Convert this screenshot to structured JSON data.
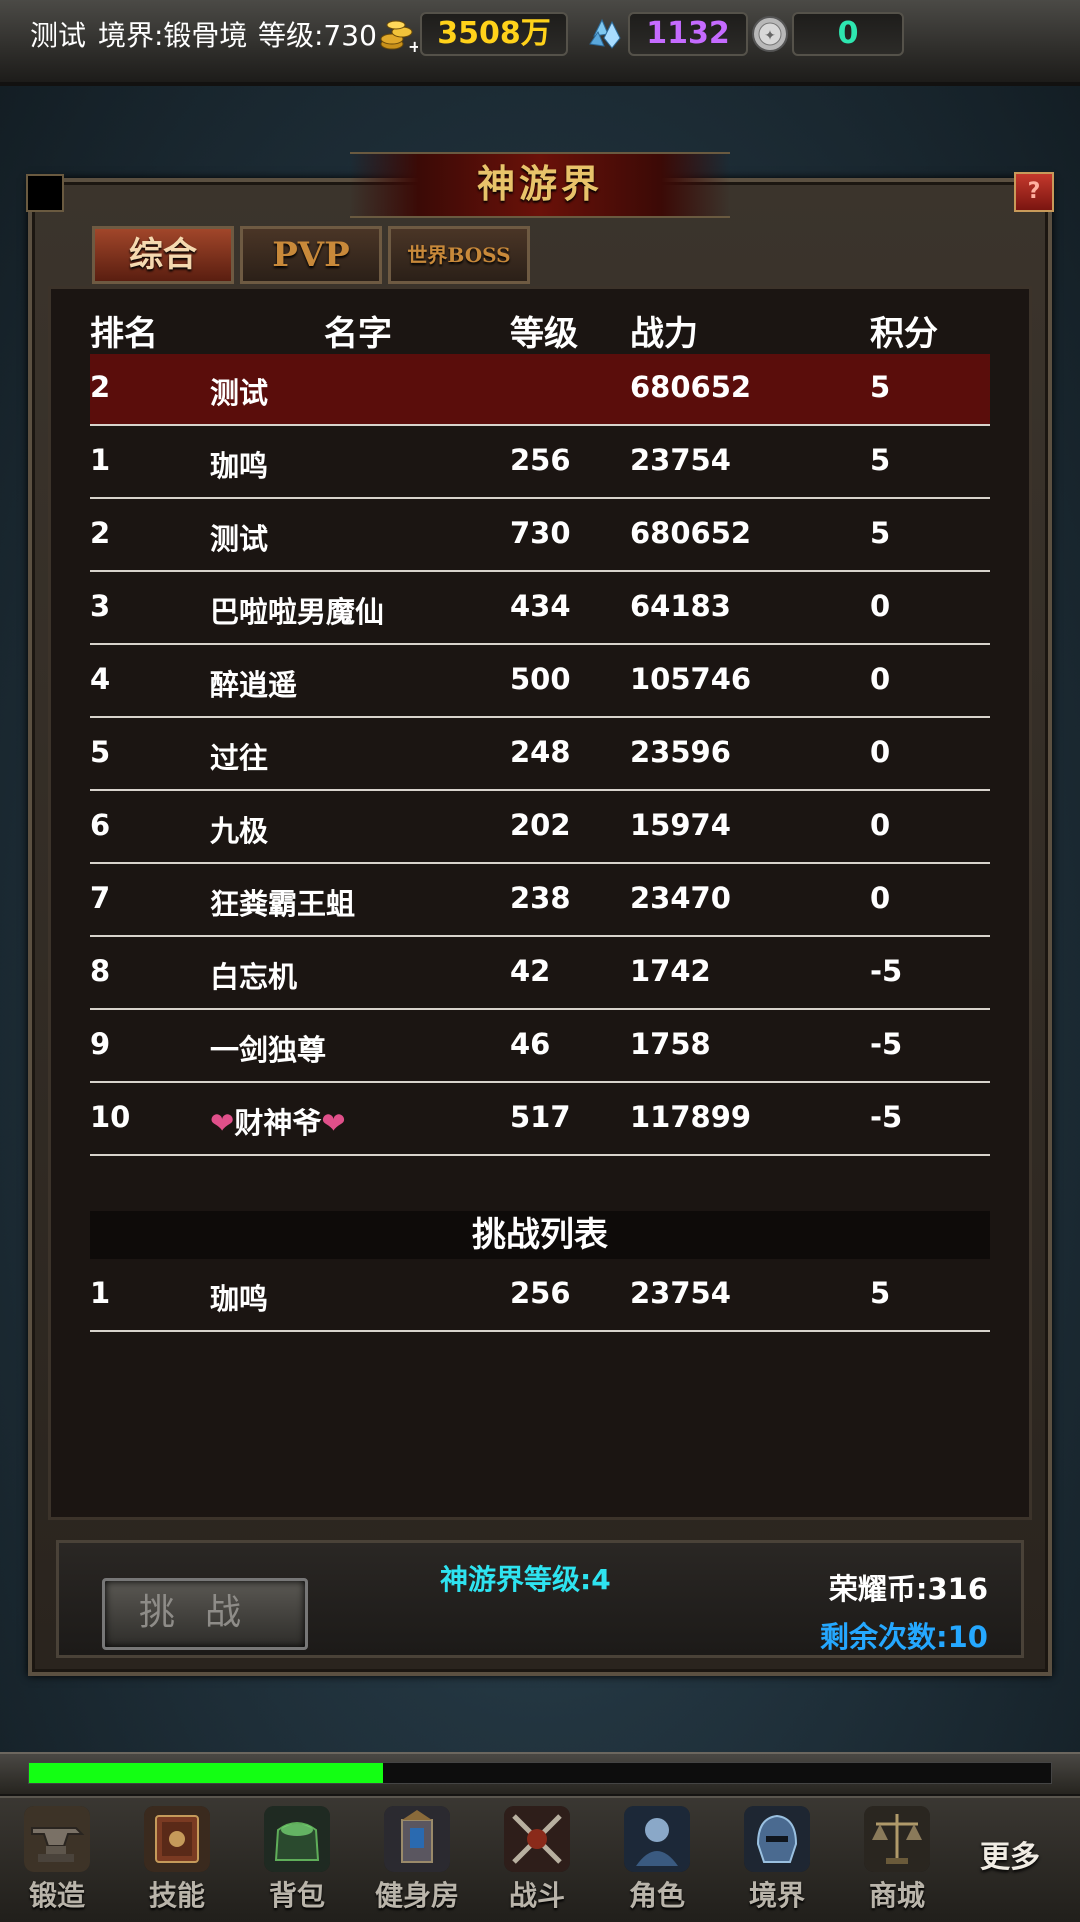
{
  "top_bar": {
    "player_name": "测试",
    "realm": "境界:锻骨境",
    "level": "等级:730",
    "gold": "3508万",
    "crystal": "1132",
    "coin": "0",
    "colors": {
      "gold": "#ffd21a",
      "crystal": "#c56bff",
      "coin": "#2ee6b0"
    }
  },
  "panel": {
    "title": "神游界",
    "help_label": "?",
    "tabs": [
      {
        "label": "综合",
        "active": true
      },
      {
        "label": "PVP",
        "active": false
      },
      {
        "label": "世界BOSS",
        "active": false
      }
    ]
  },
  "ranking": {
    "headers": [
      "排名",
      "名字",
      "等级",
      "战力",
      "积分"
    ],
    "self_row": {
      "rank": "2",
      "name": "测试",
      "level": "",
      "power": "680652",
      "score": "5"
    },
    "rows": [
      {
        "rank": "1",
        "name": "珈鸣",
        "level": "256",
        "power": "23754",
        "score": "5"
      },
      {
        "rank": "2",
        "name": "测试",
        "level": "730",
        "power": "680652",
        "score": "5"
      },
      {
        "rank": "3",
        "name": "巴啦啦男魔仙",
        "level": "434",
        "power": "64183",
        "score": "0"
      },
      {
        "rank": "4",
        "name": "醉逍遥",
        "level": "500",
        "power": "105746",
        "score": "0"
      },
      {
        "rank": "5",
        "name": "过往",
        "level": "248",
        "power": "23596",
        "score": "0"
      },
      {
        "rank": "6",
        "name": "九极",
        "level": "202",
        "power": "15974",
        "score": "0"
      },
      {
        "rank": "7",
        "name": "狂粪霸王蛆",
        "level": "238",
        "power": "23470",
        "score": "0"
      },
      {
        "rank": "8",
        "name": "白忘机",
        "level": "42",
        "power": "1742",
        "score": "-5"
      },
      {
        "rank": "9",
        "name": "一剑独尊",
        "level": "46",
        "power": "1758",
        "score": "-5"
      },
      {
        "rank": "10",
        "name": "❤财神爷❤",
        "level": "517",
        "power": "117899",
        "score": "-5"
      }
    ]
  },
  "challenge_list": {
    "title": "挑战列表",
    "rows": [
      {
        "rank": "1",
        "name": "珈鸣",
        "level": "256",
        "power": "23754",
        "score": "5"
      }
    ]
  },
  "bottom": {
    "challenge_button": "挑战",
    "realm_level": "神游界等级:4",
    "honor_coin": "荣耀币:316",
    "remaining": "剩余次数:10"
  },
  "progress": {
    "fraction": 0.346,
    "color": "#13ff13"
  },
  "nav": {
    "items": [
      {
        "label": "锻造",
        "icon": "anvil-icon"
      },
      {
        "label": "技能",
        "icon": "skill-book-icon"
      },
      {
        "label": "背包",
        "icon": "bag-icon"
      },
      {
        "label": "健身房",
        "icon": "gym-icon"
      },
      {
        "label": "战斗",
        "icon": "battle-icon"
      },
      {
        "label": "角色",
        "icon": "character-icon"
      },
      {
        "label": "境界",
        "icon": "realm-helmet-icon"
      },
      {
        "label": "商城",
        "icon": "shop-icon"
      }
    ],
    "more_label": "更多"
  }
}
